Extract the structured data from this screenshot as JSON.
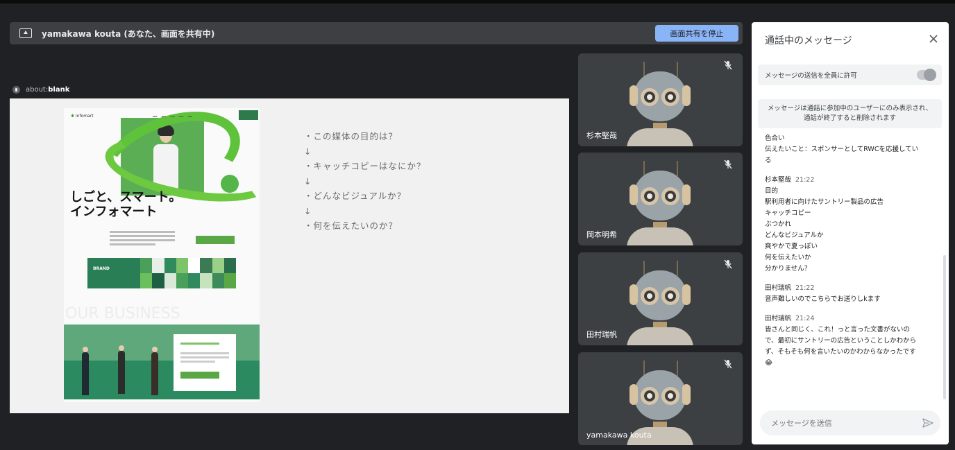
{
  "share_bar": {
    "title": "yamakawa kouta (あなた、画面を共有中)",
    "stop_label": "画面共有を停止",
    "icon": "screen-share-icon"
  },
  "tab": {
    "prefix": "about:",
    "host": "blank"
  },
  "shared_page": {
    "logo": "infomart",
    "headline": "しごと、スマート。\nインフォマート",
    "brand_label": "BRAND",
    "business_ghost": "OUR BUSINESS",
    "questions": [
      "・この媒体の目的は？",
      "↓",
      "・キャッチコピーはなにか？",
      "↓",
      "・どんなビジュアルか？",
      "↓",
      "・何を伝えたいのか？"
    ]
  },
  "participants": [
    {
      "name": "杉本堅哉",
      "icon": "mic-off-icon"
    },
    {
      "name": "岡本明希",
      "icon": "mic-off-icon"
    },
    {
      "name": "田村瑞帆",
      "icon": "mic-off-icon"
    },
    {
      "name": "yamakawa kouta",
      "icon": "mic-off-icon"
    }
  ],
  "chat": {
    "title": "通話中のメッセージ",
    "allow_label": "メッセージの送信を全員に許可",
    "notice": "メッセージは通話に参加中のユーザーにのみ表示され、\n通話が終了すると削除されます",
    "first_lines": [
      "色合い",
      "伝えたいこと：スポンサーとしてRWCを応援してい",
      "る"
    ],
    "messages": [
      {
        "sender": "杉本堅哉",
        "time": "21:22",
        "lines": [
          "目的",
          "駅利用者に向けたサントリー製品の広告",
          "キャッチコピー",
          "ぶつかれ",
          "どんなビジュアルか",
          "爽やかで夏っぽい",
          "何を伝えたいか",
          "分かりません？"
        ]
      },
      {
        "sender": "田村瑞帆",
        "time": "21:22",
        "lines": [
          "音声難しいのでこちらでお送りしkます"
        ]
      },
      {
        "sender": "田村瑞帆",
        "time": "21:24",
        "lines": [
          "皆さんと同じく、これ！っと言った文書がないの",
          "で、最初にサントリーの広告ということしかわから",
          "ず、そもそも何を言いたいのかわからなかったです",
          "😂"
        ]
      }
    ],
    "input_placeholder": "メッセージを送信",
    "send_icon": "send-icon",
    "close_icon": "close-icon"
  }
}
